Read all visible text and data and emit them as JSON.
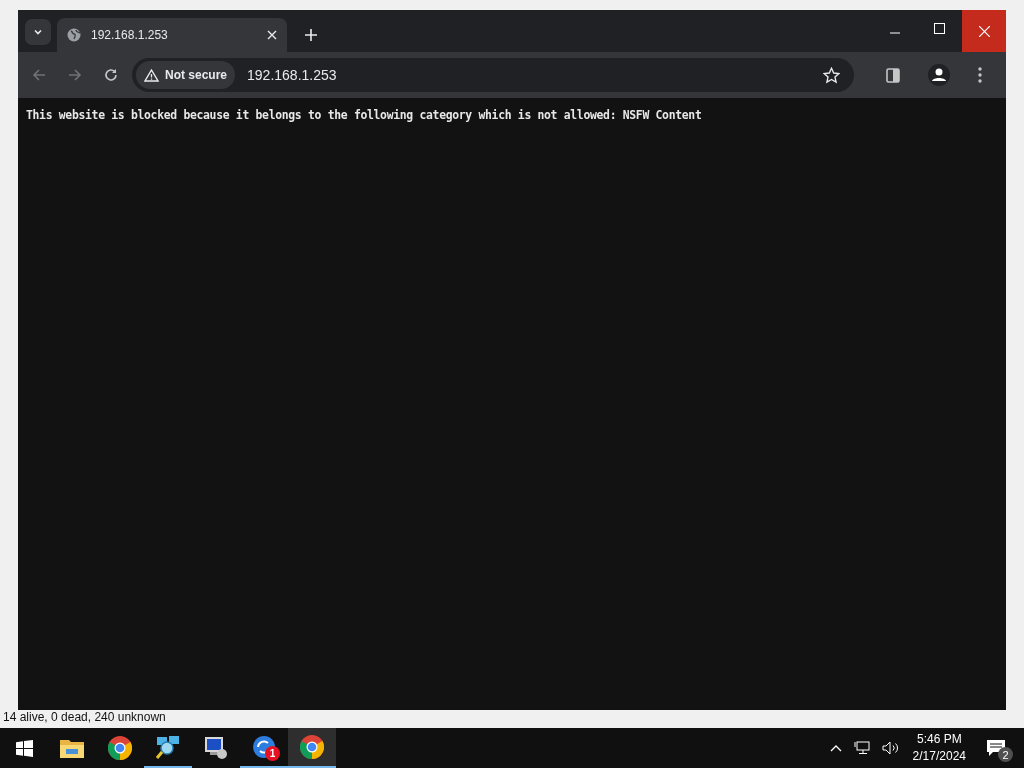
{
  "browser": {
    "tabs": [
      {
        "title": "192.168.1.253",
        "selected": true
      }
    ],
    "security": "Not secure",
    "address": "192.168.1.253",
    "message": "This website is blocked because it belongs to the following category which is not allowed: NSFW Content"
  },
  "app_status": "14 alive, 0 dead, 240 unknown",
  "taskbar": {
    "apps": [
      {
        "kind": "explorer",
        "running": false,
        "active": false
      },
      {
        "kind": "chrome",
        "running": false,
        "active": false
      },
      {
        "kind": "scanner",
        "running": true,
        "active": false
      },
      {
        "kind": "computer",
        "running": false,
        "active": false
      },
      {
        "kind": "sync",
        "running": true,
        "active": false,
        "badge": "1"
      },
      {
        "kind": "chrome",
        "running": true,
        "active": true
      }
    ],
    "time": "5:46 PM",
    "date": "2/17/2024",
    "notifications": "2"
  }
}
